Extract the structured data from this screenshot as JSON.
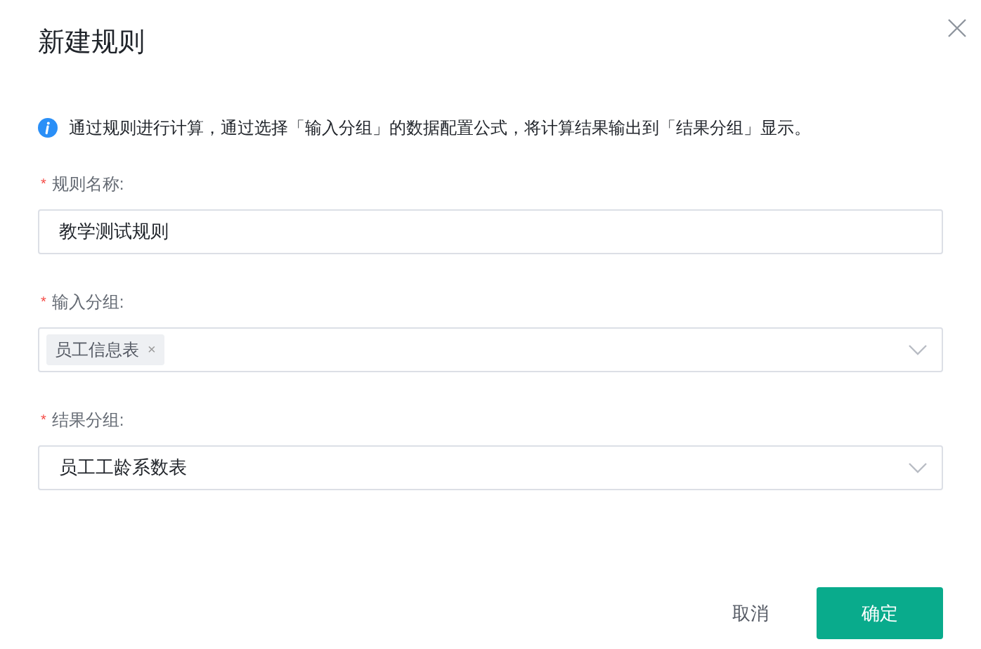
{
  "dialog": {
    "title": "新建规则",
    "info": "通过规则进行计算，通过选择「输入分组」的数据配置公式，将计算结果输出到「结果分组」显示。"
  },
  "fields": [
    {
      "kind": "input",
      "required_mark": "*",
      "label": "规则名称:",
      "value": "教学测试规则"
    },
    {
      "kind": "tags",
      "required_mark": "*",
      "label": "输入分组:",
      "tags": [
        {
          "label": "员工信息表",
          "remove": "×"
        }
      ]
    },
    {
      "kind": "select",
      "required_mark": "*",
      "label": "结果分组:",
      "value": "员工工龄系数表"
    }
  ],
  "buttons": {
    "cancel": "取消",
    "ok": "确定"
  }
}
